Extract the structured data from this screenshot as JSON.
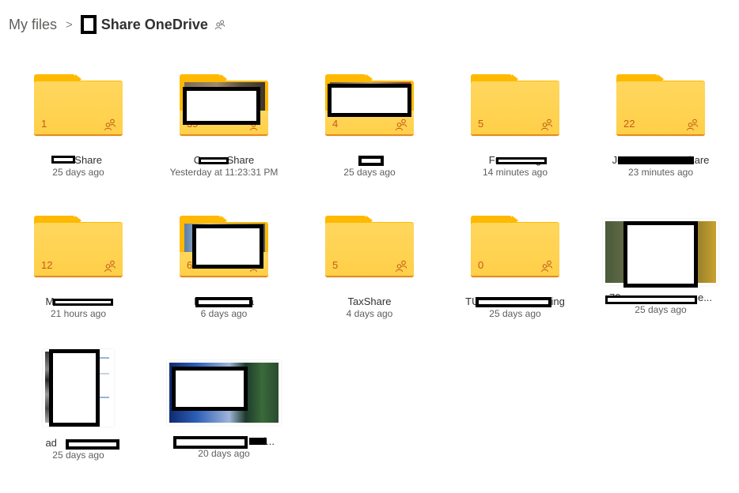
{
  "breadcrumb": {
    "root": "My files",
    "separator": ">",
    "current": "Share OneDrive",
    "current_icon": "shared-people-icon"
  },
  "colors": {
    "folder_tab": "#ffb900",
    "folder_body": "#ffd75e",
    "folder_count_text": "#c25c17",
    "folder_bottom_edge": "#e8891e"
  },
  "items": [
    {
      "type": "folder",
      "name": "▇▇ Share",
      "count": "1",
      "date": "25 days ago",
      "shared": true,
      "thumbnail": false
    },
    {
      "type": "folder",
      "name": "C▇▇▇ Share",
      "count": "39",
      "date": "Yesterday at 11:23:31 PM",
      "shared": true,
      "thumbnail": true
    },
    {
      "type": "folder",
      "name": "▇▇▇",
      "count": "4",
      "date": "25 days ago",
      "shared": true,
      "thumbnail": true
    },
    {
      "type": "folder",
      "name": "Fr▇▇▇▇▇▇g",
      "count": "5",
      "date": "14 minutes ago",
      "shared": true,
      "thumbnail": false
    },
    {
      "type": "folder",
      "name": "Je▇▇▇▇▇▇▇▇▇▇▇hare",
      "count": "22",
      "date": "23 minutes ago",
      "shared": true,
      "thumbnail": false
    },
    {
      "type": "folder",
      "name": "Ma▇▇▇▇▇▇▇▇e",
      "count": "12",
      "date": "21 hours ago",
      "shared": true,
      "thumbnail": false
    },
    {
      "type": "folder",
      "name": "M▇▇▇▇▇▇▇ta",
      "count": "6",
      "date": "6 days ago",
      "shared": true,
      "thumbnail": true
    },
    {
      "type": "folder",
      "name": "TaxShare",
      "count": "5",
      "date": "4 days ago",
      "shared": true,
      "thumbnail": false
    },
    {
      "type": "folder",
      "name": "TU▇▇▇▇▇▇▇▇▇▇ring",
      "count": "0",
      "date": "25 days ago",
      "shared": true,
      "thumbnail": false
    },
    {
      "type": "image",
      "name": "70▇▇▇▇▇▇▇▇▇▇one...",
      "date": "25 days ago"
    },
    {
      "type": "document",
      "name": "ad▇▇▇▇▇▇▇",
      "date": "25 days ago"
    },
    {
      "type": "image",
      "name": "Re▇▇▇▇▇▇▇▇▇▇ni...",
      "date": "20 days ago"
    }
  ]
}
